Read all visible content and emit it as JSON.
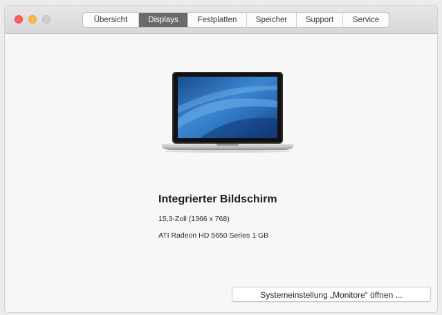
{
  "window": {
    "controls": {
      "close_icon": "close-icon",
      "minimize_icon": "minimize-icon",
      "zoom_icon": "zoom-icon"
    },
    "colors": {
      "close": "#fc605b",
      "minimize": "#fdbc40",
      "zoom_inactive": "#d0ced0",
      "active_tab": "#6b6b6b"
    }
  },
  "tabs": [
    {
      "label": "Übersicht",
      "active": false
    },
    {
      "label": "Displays",
      "active": true
    },
    {
      "label": "Festplatten",
      "active": false
    },
    {
      "label": "Speicher",
      "active": false
    },
    {
      "label": "Support",
      "active": false
    },
    {
      "label": "Service",
      "active": false
    }
  ],
  "display": {
    "image_icon": "laptop-icon",
    "title": "Integrierter Bildschirm",
    "size": "15,3-Zoll (1366 x 768)",
    "gpu": "ATI Radeon HD 5650 Series 1 GB"
  },
  "buttons": {
    "open_monitor_prefs": "Systemeinstellung „Monitore“ öffnen ..."
  }
}
